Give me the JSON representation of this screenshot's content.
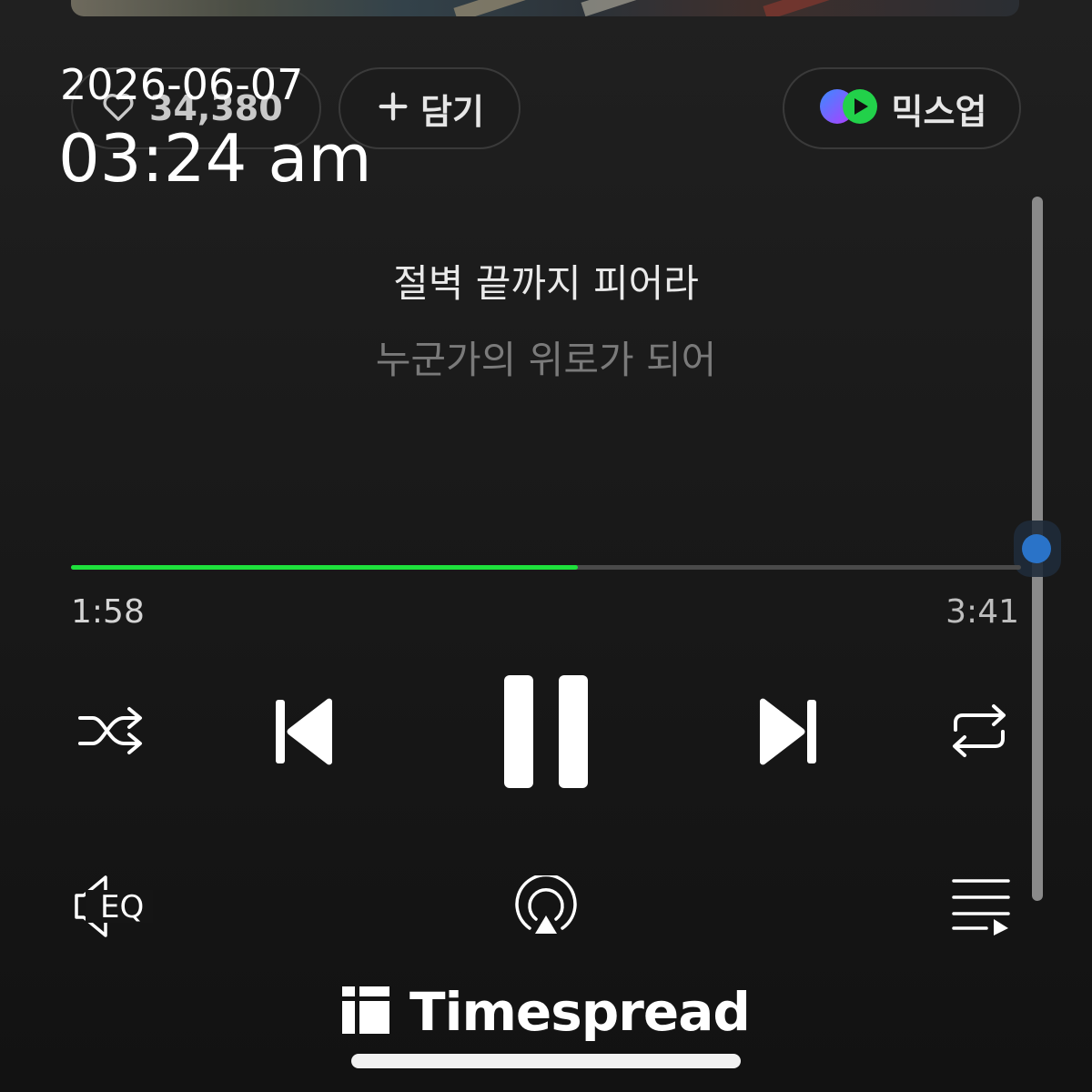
{
  "overlay": {
    "date": "2026-06-07",
    "time": "03:24 am"
  },
  "actions": {
    "like_count": "34,380",
    "add_label": "담기",
    "mixup_label": "믹스업"
  },
  "lyrics": {
    "current": "절벽 끝까지 피어라",
    "next": "누군가의 위로가 되어"
  },
  "playback": {
    "elapsed": "1:58",
    "total": "3:41",
    "progress_fraction": 0.534
  },
  "controls": {
    "shuffle_icon": "shuffle-icon",
    "previous_icon": "previous-track-icon",
    "play_pause_icon": "pause-icon",
    "next_icon": "next-track-icon",
    "repeat_icon": "repeat-icon",
    "eq_label": "EQ",
    "airplay_icon": "airplay-icon",
    "playlist_icon": "playlist-icon"
  },
  "watermark": {
    "brand": "Timespread"
  },
  "colors": {
    "progress": "#1ee13c",
    "background": "#1a1a1a",
    "scroll_indicator": "#2a73c8"
  }
}
